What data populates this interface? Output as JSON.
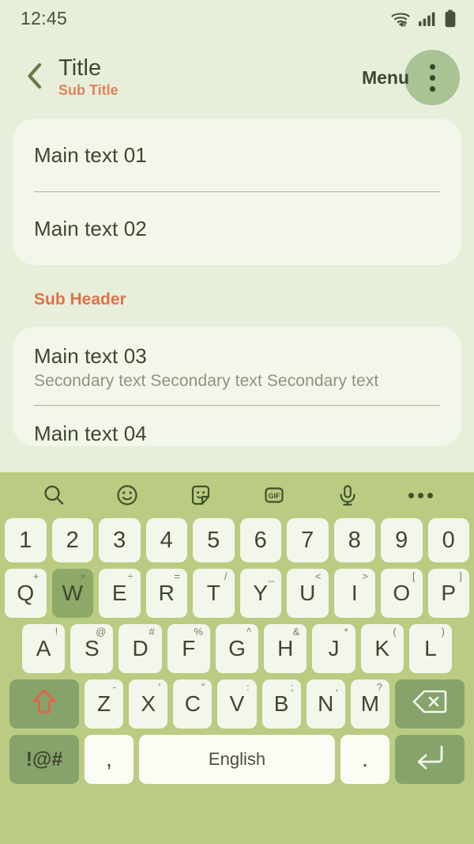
{
  "statusbar": {
    "time": "12:45",
    "icons": [
      "wifi-icon",
      "signal-icon",
      "battery-icon"
    ]
  },
  "appbar": {
    "back_icon": "chevron-left-icon",
    "title": "Title",
    "subtitle": "Sub Title",
    "menu_label": "Menu",
    "overflow_icon": "more-vertical-icon"
  },
  "colors": {
    "page_bg": "#e7efdb",
    "card_bg": "#f3f6ea",
    "accent_orange": "#e0714a",
    "subtitle_orange": "#e0845c",
    "text_dark": "#3f4630",
    "text_secondary": "#8e9382",
    "keyboard_bg": "#b9cc82",
    "key_bg": "#f3f6ea",
    "key_dark_bg": "#85a36a",
    "key_pressed_bg": "#8ea868",
    "menu_circle_bg": "#a9c394"
  },
  "content": {
    "card1": [
      {
        "main": "Main text 01"
      },
      {
        "main": "Main text 02"
      }
    ],
    "subheader": "Sub Header",
    "card2": [
      {
        "main": "Main text 03",
        "secondary": "Secondary text Secondary text Secondary text"
      },
      {
        "main": "Main text 04"
      }
    ]
  },
  "keyboard": {
    "toolbar": [
      {
        "name": "search-icon"
      },
      {
        "name": "emoji-icon"
      },
      {
        "name": "sticker-icon"
      },
      {
        "name": "gif-icon",
        "label": "GIF"
      },
      {
        "name": "microphone-icon"
      },
      {
        "name": "more-horizontal-icon"
      }
    ],
    "row_numbers": [
      {
        "key": "1"
      },
      {
        "key": "2"
      },
      {
        "key": "3"
      },
      {
        "key": "4"
      },
      {
        "key": "5"
      },
      {
        "key": "6"
      },
      {
        "key": "7"
      },
      {
        "key": "8"
      },
      {
        "key": "9"
      },
      {
        "key": "0"
      }
    ],
    "row_top": [
      {
        "key": "Q",
        "alt": "+"
      },
      {
        "key": "W",
        "alt": "×",
        "pressed": true
      },
      {
        "key": "E",
        "alt": "÷"
      },
      {
        "key": "R",
        "alt": "="
      },
      {
        "key": "T",
        "alt": "/"
      },
      {
        "key": "Y",
        "alt": "_"
      },
      {
        "key": "U",
        "alt": "<"
      },
      {
        "key": "I",
        "alt": ">"
      },
      {
        "key": "O",
        "alt": "["
      },
      {
        "key": "P",
        "alt": "]"
      }
    ],
    "row_home": [
      {
        "key": "A",
        "alt": "!"
      },
      {
        "key": "S",
        "alt": "@"
      },
      {
        "key": "D",
        "alt": "#"
      },
      {
        "key": "F",
        "alt": "%"
      },
      {
        "key": "G",
        "alt": "^"
      },
      {
        "key": "H",
        "alt": "&"
      },
      {
        "key": "J",
        "alt": "*"
      },
      {
        "key": "K",
        "alt": "("
      },
      {
        "key": "L",
        "alt": ")"
      }
    ],
    "row_bottom_letters": [
      {
        "key": "Z",
        "alt": "-"
      },
      {
        "key": "X",
        "alt": "'"
      },
      {
        "key": "C",
        "alt": "\""
      },
      {
        "key": "V",
        "alt": ":"
      },
      {
        "key": "B",
        "alt": ";"
      },
      {
        "key": "N",
        "alt": ","
      },
      {
        "key": "M",
        "alt": "?"
      }
    ],
    "shift_icon": "shift-up-arrow-icon",
    "backspace_icon": "backspace-icon",
    "symbols_key": "!@#",
    "comma_key": ",",
    "space_key": "English",
    "period_key": ".",
    "enter_icon": "enter-return-icon"
  }
}
